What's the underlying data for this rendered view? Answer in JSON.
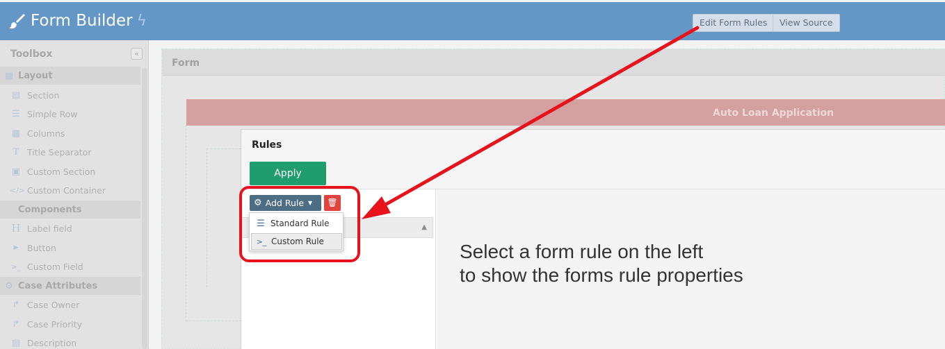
{
  "header": {
    "title": "Form Builder",
    "edit_rules_label": "Edit Form Rules",
    "view_source_label": "View Source",
    "brand_color": "#6497c6"
  },
  "sidebar": {
    "title": "Toolbox",
    "collapse_glyph": "«",
    "items": [
      {
        "label": "Layout",
        "icon": "table-icon",
        "category": true
      },
      {
        "label": "Section",
        "icon": "section-icon"
      },
      {
        "label": "Simple Row",
        "icon": "rows-icon"
      },
      {
        "label": "Columns",
        "icon": "grid-icon"
      },
      {
        "label": "Title Separator",
        "icon": "text-icon"
      },
      {
        "label": "Custom Section",
        "icon": "code-file-icon"
      },
      {
        "label": "Custom Container",
        "icon": "code-icon"
      },
      {
        "label": "Components",
        "icon": "",
        "category": true
      },
      {
        "label": "Label field",
        "icon": "heading-icon"
      },
      {
        "label": "Button",
        "icon": "play-icon"
      },
      {
        "label": "Custom Field",
        "icon": "terminal-icon"
      },
      {
        "label": "Case Attributes",
        "icon": "gear-icon",
        "category": true
      },
      {
        "label": "Case Owner",
        "icon": "share-icon"
      },
      {
        "label": "Case Priority",
        "icon": "share-icon"
      },
      {
        "label": "Description",
        "icon": "section-icon"
      }
    ]
  },
  "form": {
    "label": "Form",
    "section_title": "Auto Loan Application"
  },
  "rules_dialog": {
    "title": "Rules",
    "apply_label": "Apply",
    "add_rule_label": "Add Rule",
    "menu": [
      {
        "label": "Standard Rule",
        "icon": "list-icon"
      },
      {
        "label": "Custom Rule",
        "icon": "terminal-icon"
      }
    ],
    "placeholder_line1": "Select a form rule on the left",
    "placeholder_line2": "to show the forms rule properties"
  },
  "colors": {
    "apply": "#1f9d6f",
    "delete": "#e1433f",
    "highlight": "#e8121c"
  }
}
